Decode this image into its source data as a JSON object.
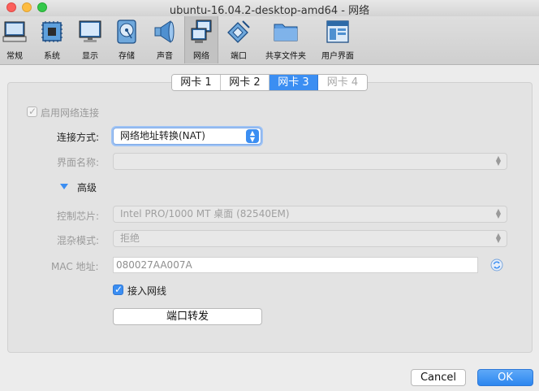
{
  "window": {
    "title": "ubuntu-16.04.2-desktop-amd64 - 网络"
  },
  "toolbar": {
    "items": [
      {
        "label": "常规",
        "icon": "general-icon"
      },
      {
        "label": "系统",
        "icon": "chip-icon"
      },
      {
        "label": "显示",
        "icon": "monitor-icon"
      },
      {
        "label": "存储",
        "icon": "disk-icon"
      },
      {
        "label": "声音",
        "icon": "speaker-icon"
      },
      {
        "label": "网络",
        "icon": "network-icon",
        "active": true
      },
      {
        "label": "端口",
        "icon": "port-icon"
      },
      {
        "label": "共享文件夹",
        "icon": "folder-icon"
      },
      {
        "label": "用户界面",
        "icon": "ui-icon"
      }
    ]
  },
  "tabs": [
    {
      "label": "网卡 1"
    },
    {
      "label": "网卡 2"
    },
    {
      "label": "网卡 3",
      "active": true
    },
    {
      "label": "网卡 4",
      "disabled": true
    }
  ],
  "form": {
    "enable_label": "启用网络连接",
    "attach_label": "连接方式:",
    "attach_value": "网络地址转换(NAT)",
    "name_label": "界面名称:",
    "name_value": "",
    "advanced_label": "高级",
    "adapter_label": "控制芯片:",
    "adapter_value": "Intel PRO/1000 MT 桌面 (82540EM)",
    "promisc_label": "混杂模式:",
    "promisc_value": "拒绝",
    "mac_label": "MAC 地址:",
    "mac_value": "080027AA007A",
    "cable_label": "接入网线",
    "port_forward_label": "端口转发"
  },
  "buttons": {
    "cancel": "Cancel",
    "ok": "OK"
  },
  "colors": {
    "accent": "#3b8ef2",
    "panel": "#e3e3e3",
    "window": "#ececec"
  }
}
